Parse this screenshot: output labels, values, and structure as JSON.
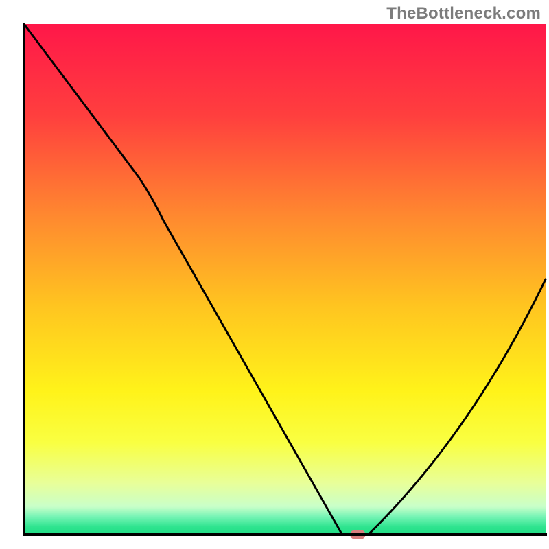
{
  "watermark": "TheBottleneck.com",
  "chart_data": {
    "type": "line",
    "title": "",
    "xlabel": "",
    "ylabel": "",
    "xlim": [
      0,
      100
    ],
    "ylim": [
      0,
      100
    ],
    "flat_minimum": {
      "x_start": 61,
      "x_end": 66,
      "y": 0
    },
    "marker": {
      "x": 64,
      "y": 0,
      "color": "#d87f7f"
    },
    "curve_points": [
      {
        "x": 0,
        "y": 100
      },
      {
        "x": 22,
        "y": 70
      },
      {
        "x": 61,
        "y": 0
      },
      {
        "x": 66,
        "y": 0
      },
      {
        "x": 100,
        "y": 50
      }
    ],
    "background_gradient": {
      "type": "vertical",
      "stops": [
        {
          "pos": 0.0,
          "color": "#ff1749"
        },
        {
          "pos": 0.18,
          "color": "#ff3f3e"
        },
        {
          "pos": 0.38,
          "color": "#ff8a2f"
        },
        {
          "pos": 0.55,
          "color": "#ffc420"
        },
        {
          "pos": 0.72,
          "color": "#fff31a"
        },
        {
          "pos": 0.82,
          "color": "#f9ff42"
        },
        {
          "pos": 0.9,
          "color": "#e8ff9a"
        },
        {
          "pos": 0.945,
          "color": "#c9ffc9"
        },
        {
          "pos": 0.965,
          "color": "#76f4b5"
        },
        {
          "pos": 0.985,
          "color": "#2fe48f"
        },
        {
          "pos": 1.0,
          "color": "#20dd85"
        }
      ]
    }
  }
}
